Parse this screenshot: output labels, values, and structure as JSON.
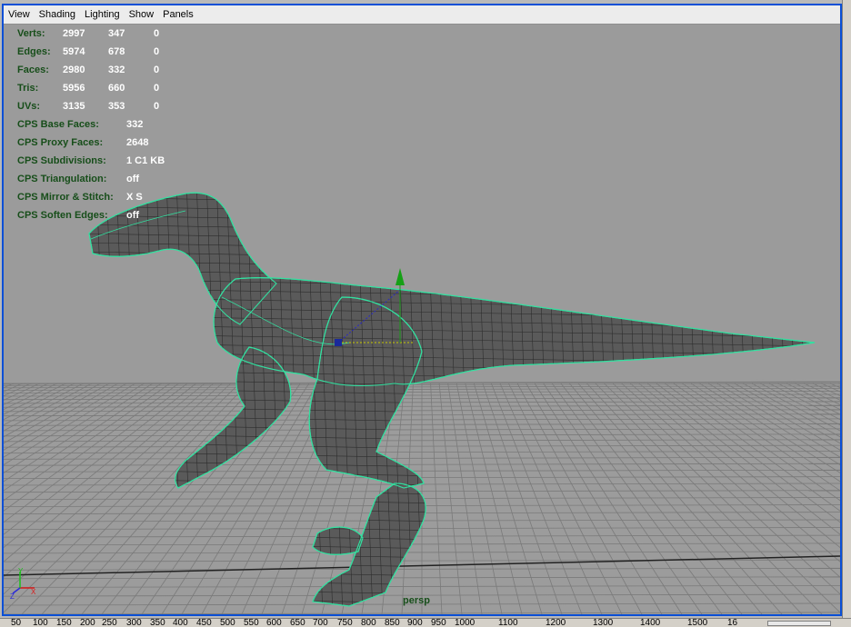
{
  "menu": [
    "View",
    "Shading",
    "Lighting",
    "Show",
    "Panels"
  ],
  "hud": {
    "stats": [
      {
        "label": "Verts:",
        "values": [
          "2997",
          "347",
          "0"
        ]
      },
      {
        "label": "Edges:",
        "values": [
          "5974",
          "678",
          "0"
        ]
      },
      {
        "label": "Faces:",
        "values": [
          "2980",
          "332",
          "0"
        ]
      },
      {
        "label": "Tris:",
        "values": [
          "5956",
          "660",
          "0"
        ]
      },
      {
        "label": "UVs:",
        "values": [
          "3135",
          "353",
          "0"
        ]
      }
    ],
    "cps": [
      {
        "label": "CPS Base Faces:",
        "value": "332"
      },
      {
        "label": "CPS Proxy Faces:",
        "value": "2648"
      },
      {
        "label": "CPS Subdivisions:",
        "value": "1 C1 KB"
      },
      {
        "label": "CPS Triangulation:",
        "value": "off"
      },
      {
        "label": "CPS Mirror & Stitch:",
        "value": "X S"
      },
      {
        "label": "CPS Soften Edges:",
        "value": "off"
      }
    ]
  },
  "camera_label": "persp",
  "ruler_ticks": [
    "50",
    "100",
    "150",
    "200",
    "250",
    "300",
    "350",
    "400",
    "450",
    "500",
    "550",
    "600",
    "650",
    "700",
    "750",
    "800",
    "850",
    "900",
    "950",
    "1000",
    "1100",
    "1200",
    "1300",
    "1400",
    "1500",
    "16"
  ],
  "colors": {
    "viewport_bg": "#9b9b9b",
    "hud_label": "#174e1a",
    "hud_value": "#ffffff",
    "active_border": "#0a4fd6",
    "wire": "#33e0a0",
    "mesh": "#5a5a5a"
  }
}
